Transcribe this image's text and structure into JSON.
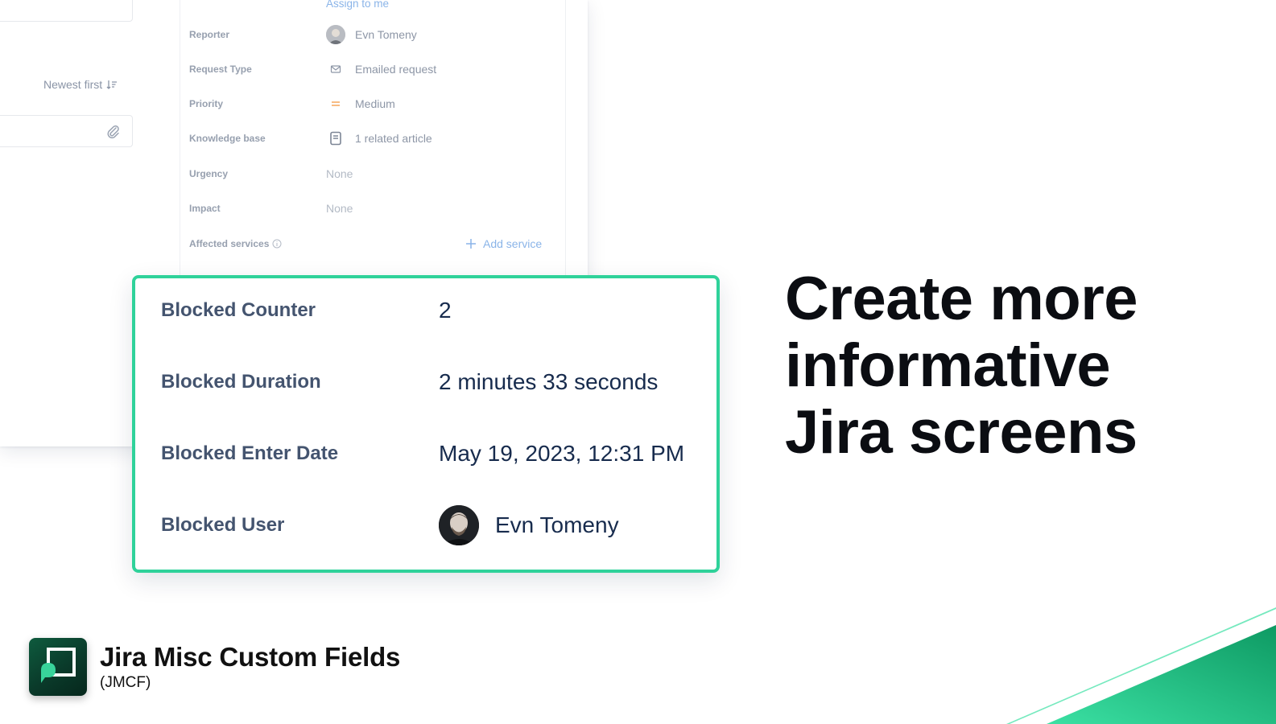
{
  "comments": {
    "sort_label": "Newest first"
  },
  "details": {
    "assign_link": "Assign to me",
    "rows": [
      {
        "label": "Reporter",
        "value": "Evn Tomeny"
      },
      {
        "label": "Request Type",
        "value": "Emailed request"
      },
      {
        "label": "Priority",
        "value": "Medium"
      },
      {
        "label": "Knowledge base",
        "value": "1 related article"
      },
      {
        "label": "Urgency",
        "value": "None"
      },
      {
        "label": "Impact",
        "value": "None"
      },
      {
        "label": "Affected services",
        "value": ""
      }
    ],
    "add_service_label": "Add service"
  },
  "card": {
    "rows": [
      {
        "label": "Blocked Counter",
        "value": "2"
      },
      {
        "label": "Blocked Duration",
        "value": "2 minutes 33 seconds"
      },
      {
        "label": "Blocked Enter Date",
        "value": "May 19, 2023, 12:31 PM"
      },
      {
        "label": "Blocked User",
        "value": "Evn Tomeny"
      }
    ]
  },
  "headline": {
    "line1": "Create more",
    "line2": "informative",
    "line3": "Jira screens"
  },
  "brand": {
    "name": "Jira Misc Custom Fields",
    "sub": "(JMCF)"
  },
  "colors": {
    "accent": "#2fd29a",
    "link": "#8ab4e8",
    "priority_medium": "#f5a55a",
    "heading": "#0b0d12"
  },
  "icons": {
    "sort": "sort-descending-icon",
    "attach": "paperclip-icon",
    "request_type": "mail-icon",
    "priority": "priority-medium-icon",
    "knowledge_base": "book-icon",
    "info": "info-icon",
    "add": "plus-icon"
  }
}
